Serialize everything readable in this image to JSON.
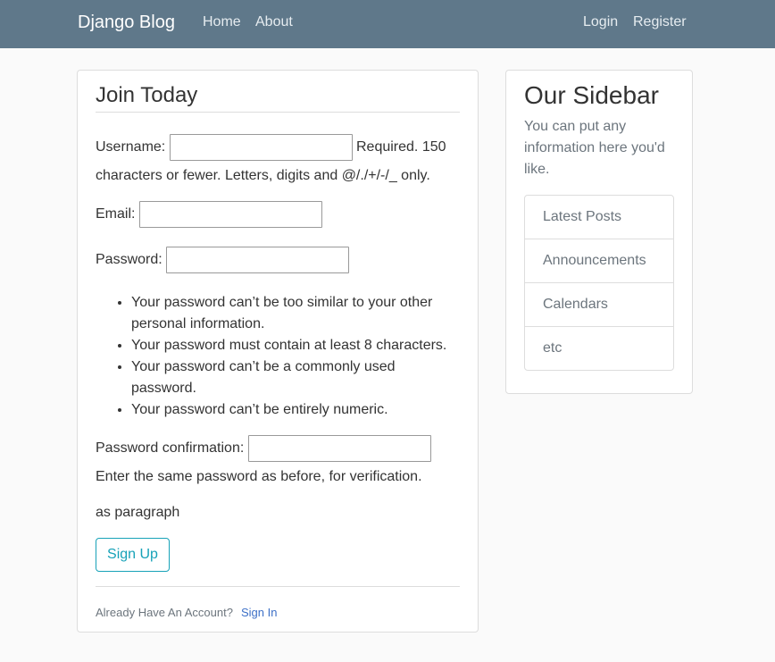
{
  "navbar": {
    "brand": "Django Blog",
    "home": "Home",
    "about": "About",
    "login": "Login",
    "register": "Register"
  },
  "form": {
    "title": "Join Today",
    "username_label": "Username:",
    "username_help_1": "Required. 150",
    "username_help_2": "characters or fewer. Letters, digits and @/./+/-/_ only.",
    "email_label": "Email:",
    "password_label": "Password:",
    "password_rules": [
      "Your password can’t be too similar to your other personal information.",
      "Your password must contain at least 8 characters.",
      "Your password can’t be a commonly used password.",
      "Your password can’t be entirely numeric."
    ],
    "confirm_label": "Password confirmation:",
    "confirm_help": "Enter the same password as before, for verification.",
    "as_paragraph": "as paragraph",
    "submit_label": "Sign Up",
    "footer_text": "Already Have An Account?",
    "footer_link": "Sign In",
    "username_value": "",
    "email_value": "",
    "password_value": "",
    "confirm_value": ""
  },
  "sidebar": {
    "title": "Our Sidebar",
    "text": "You can put any information here you'd like.",
    "items": [
      "Latest Posts",
      "Announcements",
      "Calendars",
      "etc"
    ]
  },
  "colors": {
    "navbar_bg": "#5f788a",
    "accent": "#17a2b8",
    "link": "#3d70c7",
    "muted": "#6c757d"
  }
}
